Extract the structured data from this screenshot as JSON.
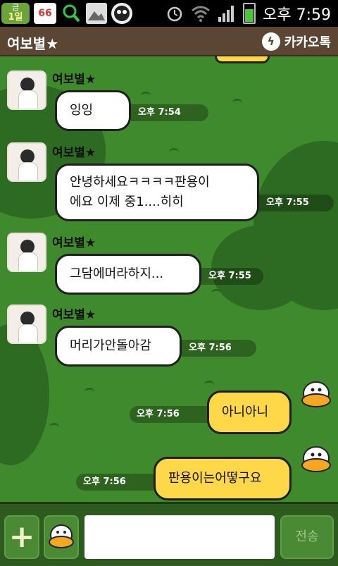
{
  "status_bar": {
    "calendar_day": "금",
    "calendar_date": "1일",
    "milk_badge": "66",
    "clock": "오후 7:59",
    "icons": [
      "calendar-icon",
      "milk-icon",
      "search-icon",
      "image-icon",
      "alien-icon",
      "alarm-icon",
      "wifi-icon",
      "signal-icon",
      "battery-icon"
    ]
  },
  "header": {
    "title": "여보별★",
    "brand": "카카오톡",
    "brand_icon": "lightning-icon"
  },
  "messages": [
    {
      "sender": "여보별★",
      "text": "잉잉",
      "time": "오후 7:54",
      "direction": "in"
    },
    {
      "sender": "여보별★",
      "text": "안녕하세요ㅋㅋㅋㅋ판용이\n에요 이제 중1....히히",
      "time": "오후 7:55",
      "direction": "in"
    },
    {
      "sender": "여보별★",
      "text": "그담에머라하지...",
      "time": "오후 7:55",
      "direction": "in"
    },
    {
      "sender": "여보별★",
      "text": "머리가안돌아감",
      "time": "오후 7:56",
      "direction": "in"
    },
    {
      "text": "아니아니",
      "time": "오후 7:56",
      "direction": "out"
    },
    {
      "text": "판용이는어떻구요",
      "time": "오후 7:56",
      "direction": "out"
    }
  ],
  "input": {
    "value": "",
    "placeholder": ""
  },
  "buttons": {
    "plus": "+",
    "send": "전송"
  },
  "colors": {
    "status_bar": "#000000",
    "header": "#5a4633",
    "background": "#3f8a2c",
    "incoming_bubble": "#ffffff",
    "outgoing_bubble": "#ffd84a",
    "bottom_bar": "#2d5a1f"
  }
}
